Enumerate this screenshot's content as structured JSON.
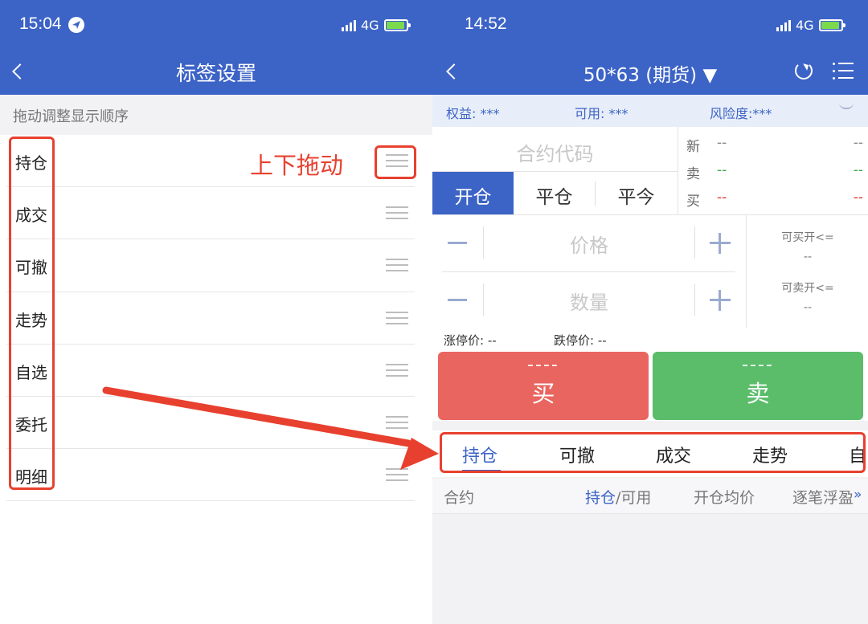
{
  "left_screen": {
    "status_time": "15:04",
    "network": "4G",
    "title": "标签设置",
    "hint": "拖动调整显示顺序",
    "annotation": "上下拖动",
    "tags": [
      "持仓",
      "成交",
      "可撤",
      "走势",
      "自选",
      "委托",
      "明细"
    ]
  },
  "right_screen": {
    "status_time": "14:52",
    "network": "4G",
    "title": "50*63 (期货) ▼",
    "account": {
      "equity": "权益: ***",
      "available": "可用: ***",
      "risk": "风险度:***"
    },
    "contract_placeholder": "合约代码",
    "trade_tabs": [
      "开仓",
      "平仓",
      "平今"
    ],
    "active_trade_tab": 0,
    "quote": [
      {
        "label": "新",
        "v1": "--",
        "v2": "--",
        "color": "#888888"
      },
      {
        "label": "卖",
        "v1": "--",
        "v2": "--",
        "color": "#3aa84a"
      },
      {
        "label": "买",
        "v1": "--",
        "v2": "--",
        "color": "#e0322b"
      }
    ],
    "price_placeholder": "价格",
    "qty_placeholder": "数量",
    "can_buy_label": "可买开<=",
    "can_buy_value": "--",
    "can_sell_label": "可卖开<=",
    "can_sell_value": "--",
    "limit_up": "涨停价: --",
    "limit_down": "跌停价: --",
    "buy_button": {
      "value": "----",
      "label": "买"
    },
    "sell_button": {
      "value": "----",
      "label": "卖"
    },
    "bottom_tabs": [
      "持仓",
      "可撤",
      "成交",
      "走势",
      "自"
    ],
    "columns": {
      "contract": "合约",
      "position": "持仓",
      "slash_available": "/可用",
      "avg_open": "开仓均价",
      "float_pnl": "逐笔浮盈",
      "more": "»"
    }
  },
  "colors": {
    "brand_blue": "#3c63c6",
    "annotation_red": "#e8402f",
    "buy_red": "#e96560",
    "sell_green": "#5bbd6a"
  }
}
